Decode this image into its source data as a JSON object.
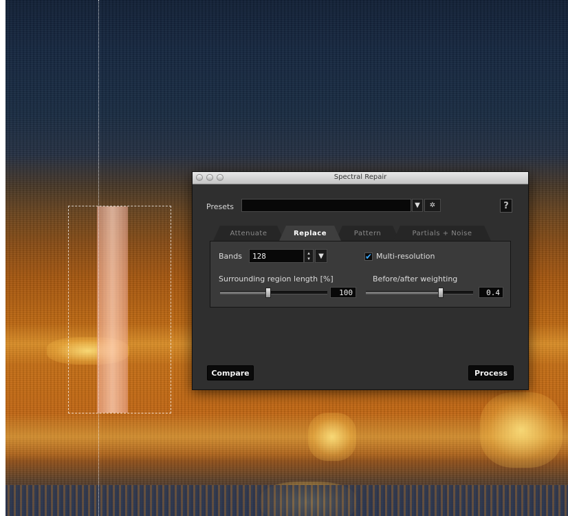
{
  "window": {
    "title": "Spectral Repair"
  },
  "presets": {
    "label": "Presets",
    "value": "",
    "dropdown_glyph": "▼",
    "gear_glyph": "✲",
    "help_glyph": "?"
  },
  "tabs": [
    {
      "label": "Attenuate",
      "active": false
    },
    {
      "label": "Replace",
      "active": true
    },
    {
      "label": "Pattern",
      "active": false
    },
    {
      "label": "Partials + Noise",
      "active": false
    }
  ],
  "bands": {
    "label": "Bands",
    "value": "128",
    "stepper_up": "▴",
    "stepper_down": "▾",
    "dropdown_glyph": "▼"
  },
  "multi_resolution": {
    "label": "Multi-resolution",
    "checked": true,
    "check_glyph": "✔"
  },
  "surrounding_region": {
    "label": "Surrounding region length [%]",
    "value": "100",
    "level": 0.45
  },
  "weighting": {
    "label": "Before/after weighting",
    "value": "0.4",
    "level": 0.7
  },
  "buttons": {
    "compare": "Compare",
    "process": "Process"
  },
  "colors": {
    "accent": "#3aa8ff",
    "dialog_bg": "#2f2f2f",
    "panel_bg": "#3a3a3a"
  }
}
